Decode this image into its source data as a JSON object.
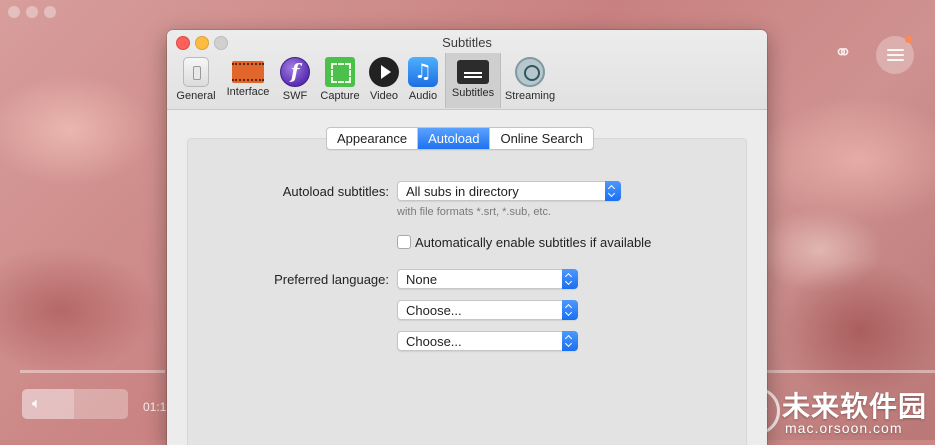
{
  "window": {
    "title": "Subtitles"
  },
  "toolbar": {
    "items": [
      {
        "label": "General",
        "icon": "general-switch-icon"
      },
      {
        "label": "Interface",
        "icon": "interface-film-icon"
      },
      {
        "label": "SWF",
        "icon": "flash-swf-icon"
      },
      {
        "label": "Capture",
        "icon": "capture-icon"
      },
      {
        "label": "Video",
        "icon": "video-play-icon"
      },
      {
        "label": "Audio",
        "icon": "audio-music-icon"
      },
      {
        "label": "Subtitles",
        "icon": "subtitles-icon",
        "selected": true
      },
      {
        "label": "Streaming",
        "icon": "streaming-airplay-icon"
      }
    ]
  },
  "tabs": [
    {
      "label": "Appearance",
      "active": false
    },
    {
      "label": "Autoload",
      "active": true
    },
    {
      "label": "Online Search",
      "active": false
    }
  ],
  "autoload": {
    "label": "Autoload subtitles:",
    "value": "All subs in directory",
    "hint": "with file formats *.srt, *.sub, etc.",
    "auto_enable_label": "Automatically enable subtitles if available",
    "auto_enable_checked": false
  },
  "language": {
    "label": "Preferred language:",
    "first": "None",
    "second": "Choose...",
    "third": "Choose..."
  },
  "background_player": {
    "time": "01:1"
  },
  "watermark": {
    "name": "未来软件园",
    "url": "mac.orsoon.com"
  },
  "colors": {
    "accent": "#1f72f0",
    "close": "#fc605b",
    "minimize": "#fdbc40"
  }
}
